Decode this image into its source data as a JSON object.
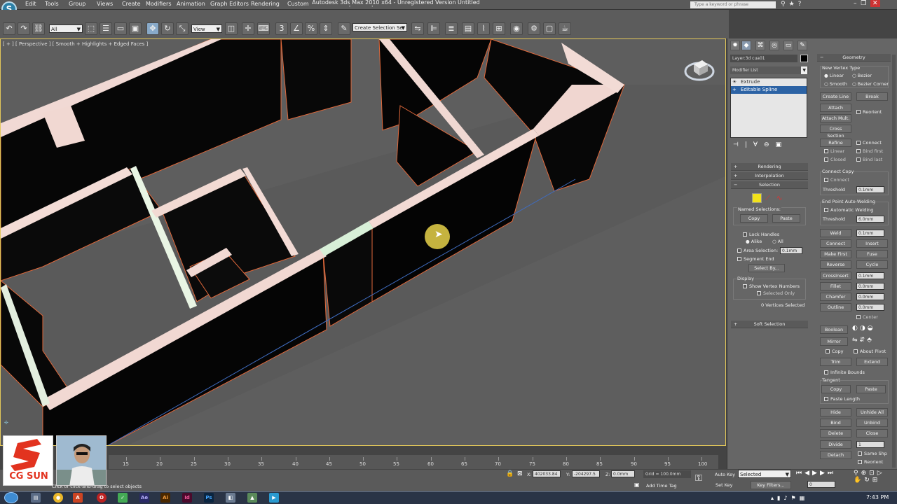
{
  "title_bar": {
    "window_title": "Autodesk 3ds Max 2010 x64 - Unregistered Version   Untitled",
    "search_placeholder": "Type a keyword or phrase",
    "menus": [
      "Edit",
      "Tools",
      "Group",
      "Views",
      "Create",
      "Modifiers",
      "Animation",
      "Graph Editors",
      "Rendering",
      "Customize",
      "MAXScript",
      "Help"
    ]
  },
  "toolbar": {
    "selection_filter": "All",
    "reference_coord": "View",
    "named_selection": "Create Selection Se"
  },
  "viewport": {
    "label": "[ + ] [ Perspective ] [ Smooth + Highlights + Edged Faces ]"
  },
  "command_panel": {
    "object_name": "Layer:3d cua01",
    "modifier_list_label": "Modifier List",
    "stack_items": [
      "Extrude",
      "Editable Spline"
    ],
    "rollouts": {
      "rendering": "Rendering",
      "interpolation": "Interpolation",
      "selection": "Selection",
      "soft_selection": "Soft Selection",
      "geometry": "Geometry"
    },
    "selection": {
      "named_selections_label": "Named Selections:",
      "copy": "Copy",
      "paste": "Paste",
      "lock_handles": "Lock Handles",
      "alike": "Alike",
      "all": "All",
      "area_selection": "Area Selection:",
      "area_value": "0.1mm",
      "segment_end": "Segment End",
      "select_by": "Select By...",
      "display_label": "Display",
      "show_vertex_numbers": "Show Vertex Numbers",
      "selected_only": "Selected Only",
      "status": "0 Vertices Selected"
    },
    "geometry": {
      "new_vertex_type": "New Vertex Type",
      "linear": "Linear",
      "bezier": "Bezier",
      "smooth": "Smooth",
      "bezier_corner": "Bezier Corner",
      "create_line": "Create Line",
      "break": "Break",
      "attach": "Attach",
      "reorient": "Reorient",
      "attach_mult": "Attach Mult.",
      "cross_section": "Cross Section",
      "refine": "Refine",
      "connect": "Connect",
      "linear_cb": "Linear",
      "bind_first": "Bind first",
      "closed": "Closed",
      "bind_last": "Bind last",
      "connect_copy": "Connect Copy",
      "connect_cb": "Connect",
      "threshold": "Threshold",
      "threshold_value": "0.1mm",
      "end_point_welding": "End Point Auto-Welding",
      "automatic_welding": "Automatic Welding",
      "threshold2_value": "6.0mm",
      "weld": "Weld",
      "weld_value": "0.1mm",
      "connect_btn": "Connect",
      "insert": "Insert",
      "make_first": "Make First",
      "fuse": "Fuse",
      "reverse": "Reverse",
      "cycle": "Cycle",
      "crossinsert": "CrossInsert",
      "crossinsert_value": "0.1mm",
      "fillet": "Fillet",
      "fillet_value": "0.0mm",
      "chamfer": "Chamfer",
      "chamfer_value": "0.0mm",
      "outline": "Outline",
      "outline_value": "0.0mm",
      "center": "Center",
      "boolean": "Boolean",
      "mirror": "Mirror",
      "copy_cb": "Copy",
      "about_pivot": "About Pivot",
      "trim": "Trim",
      "extend": "Extend",
      "infinite_bounds": "Infinite Bounds",
      "tangent": "Tangent",
      "tangent_copy": "Copy",
      "tangent_paste": "Paste",
      "paste_length": "Paste Length",
      "hide": "Hide",
      "unhide_all": "Unhide All",
      "bind": "Bind",
      "unbind": "Unbind",
      "delete": "Delete",
      "close": "Close",
      "divide": "Divide",
      "divide_value": "1",
      "detach": "Detach",
      "same_shp": "Same Shp",
      "reorient2": "Reorient"
    }
  },
  "timeline": {
    "ticks": [
      15,
      20,
      25,
      30,
      35,
      40,
      45,
      50,
      55,
      60,
      65,
      70,
      75,
      80,
      85,
      90,
      95,
      100
    ]
  },
  "status": {
    "prompt": "Click or click-and-drag to select objects",
    "welcome": "Welcome to M",
    "x_label": "X:",
    "x_value": "402033.84",
    "y_label": "Y:",
    "y_value": "-204297.5",
    "z_label": "Z:",
    "z_value": "0.0mm",
    "grid": "Grid = 100.0mm",
    "add_time_tag": "Add Time Tag",
    "auto_key": "Auto Key",
    "set_key": "Set Key",
    "key_mode": "Selected",
    "key_filters": "Key Filters...",
    "frame": "0"
  },
  "watermark": {
    "brand": "CG SUN"
  },
  "taskbar": {
    "clock": "7:43 PM",
    "apps": [
      "Ae",
      "Ai",
      "Id",
      "Ps"
    ]
  }
}
